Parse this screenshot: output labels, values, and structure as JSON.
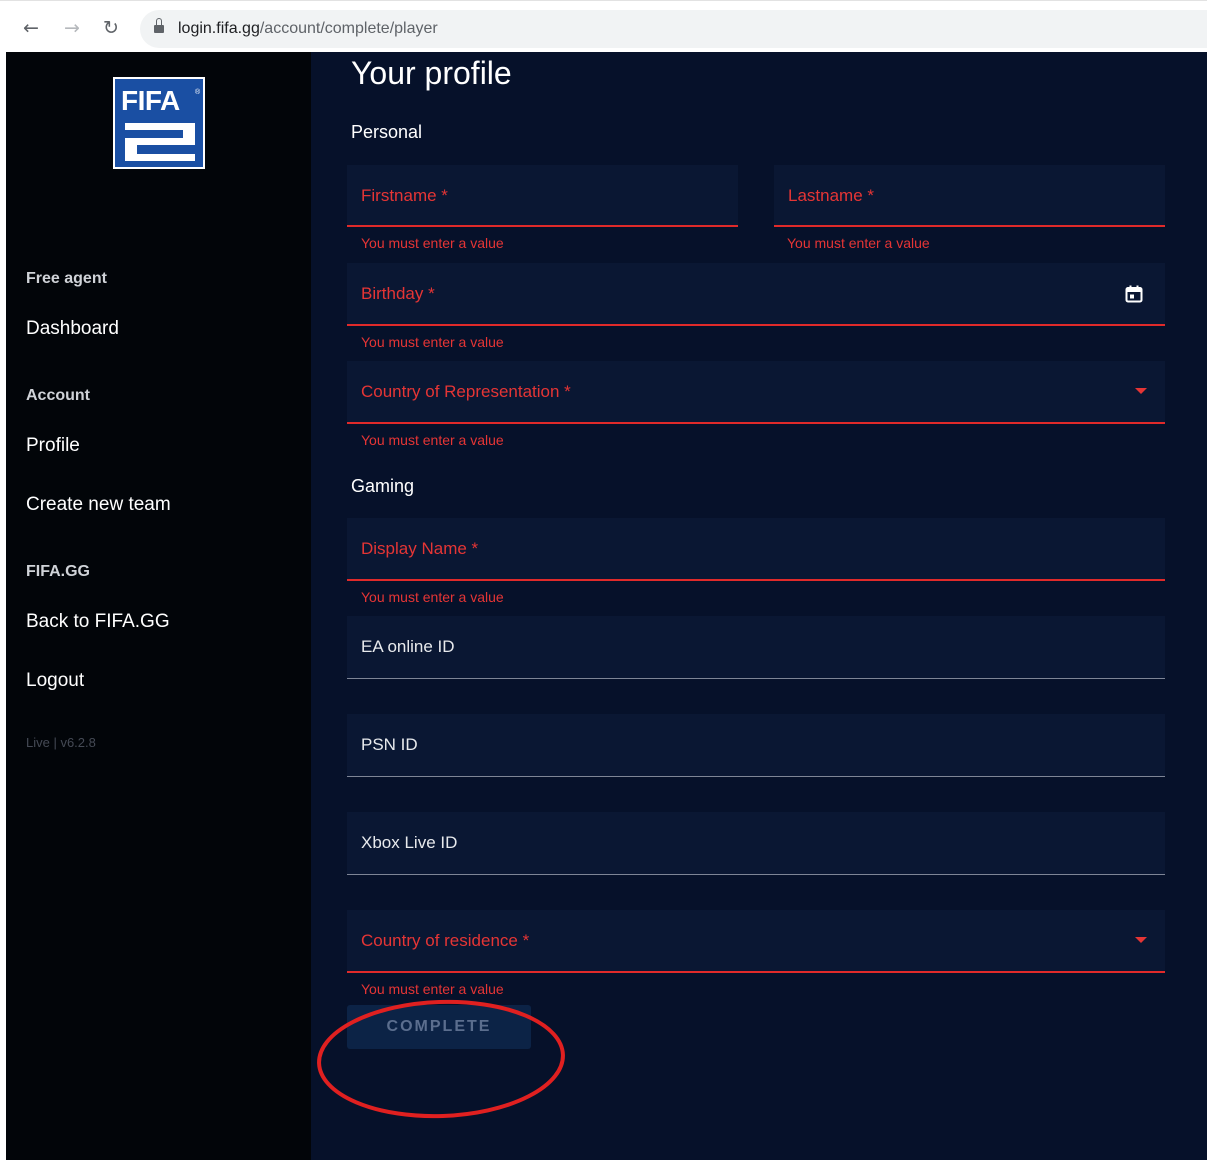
{
  "browser": {
    "url_host": "login.fifa.gg",
    "url_path": "/account/complete/player",
    "icons": [
      "back-arrow-icon",
      "forward-arrow-icon",
      "reload-icon",
      "lock-icon"
    ]
  },
  "sidebar": {
    "logo_text": "FIFA",
    "logo_mark": "®",
    "sections": [
      {
        "label": "Free agent",
        "items": [
          "Dashboard"
        ]
      },
      {
        "label": "Account",
        "items": [
          "Profile",
          "Create new team"
        ]
      },
      {
        "label": "FIFA.GG",
        "items": [
          "Back to FIFA.GG",
          "Logout"
        ]
      }
    ],
    "version": "Live | v6.2.8"
  },
  "main": {
    "title": "Your profile",
    "personal_label": "Personal",
    "gaming_label": "Gaming",
    "fields": {
      "firstname": {
        "label": "Firstname *",
        "error": "You must enter a value"
      },
      "lastname": {
        "label": "Lastname *",
        "error": "You must enter a value"
      },
      "birthday": {
        "label": "Birthday *",
        "error": "You must enter a value"
      },
      "country_rep": {
        "label": "Country of Representation *",
        "error": "You must enter a value"
      },
      "display_name": {
        "label": "Display Name *",
        "error": "You must enter a value"
      },
      "ea_id": {
        "label": "EA online ID"
      },
      "psn_id": {
        "label": "PSN ID"
      },
      "xbox_id": {
        "label": "Xbox Live ID"
      },
      "country_res": {
        "label": "Country of residence *",
        "error": "You must enter a value"
      }
    },
    "complete_label": "COMPLETE"
  },
  "colors": {
    "error": "#e53535",
    "sidebar_bg": "#020509",
    "main_bg": "#06112a",
    "field_bg": "#0a1733",
    "annotation": "#e02020"
  }
}
